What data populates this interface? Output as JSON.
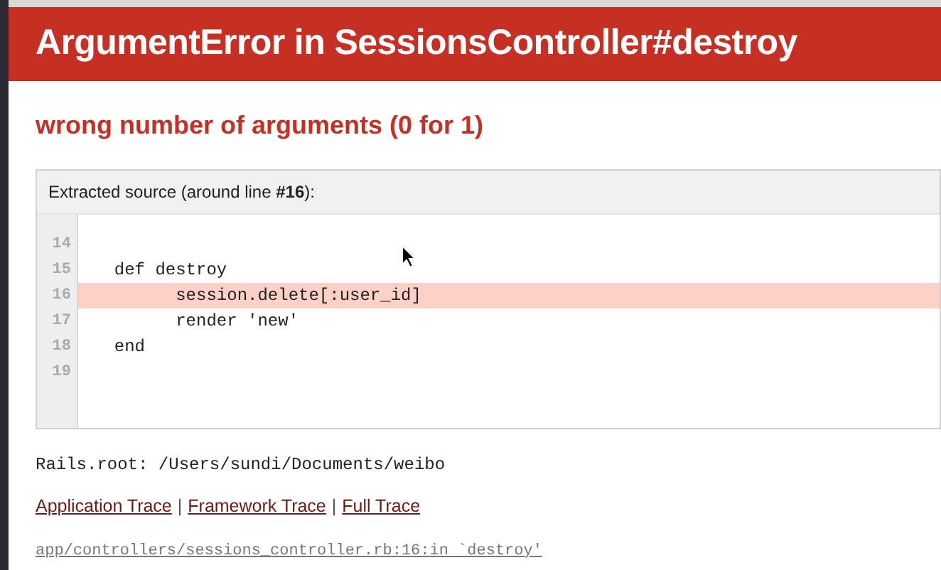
{
  "header": {
    "title": "ArgumentError in SessionsController#destroy"
  },
  "message": "wrong number of arguments (0 for 1)",
  "source": {
    "heading": "Extracted source (around line **#16**):",
    "lines": [
      {
        "number": "14",
        "selected": false
      },
      {
        "number": "15",
        "code": "  def destroy",
        "selected": false
      },
      {
        "number": "16",
        "code": "        session.delete[:user_id]",
        "selected": true
      },
      {
        "number": "17",
        "code": "        render 'new'",
        "selected": false
      },
      {
        "number": "18",
        "code": "  end",
        "selected": false
      },
      {
        "number": "19",
        "selected": false
      }
    ]
  },
  "rails_root": "Rails.root: /Users/sundi/Documents/weibo",
  "trace_links": [
    {
      "label": "Application Trace"
    },
    {
      "label": "Framework Trace"
    },
    {
      "label": "Full Trace"
    }
  ],
  "trace_separator": "|",
  "trace_entries": [
    "app/controllers/sessions_controller.rb:16:in `destroy'"
  ]
}
